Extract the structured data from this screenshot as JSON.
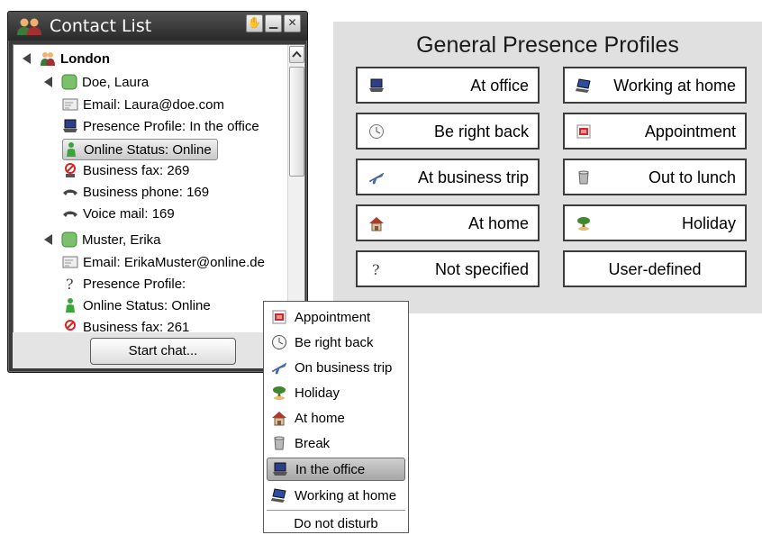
{
  "window": {
    "title": "Contact List",
    "controls": [
      "hand",
      "minimize",
      "close"
    ],
    "start_chat_label": "Start chat..."
  },
  "tree": {
    "group": "London",
    "contacts": [
      {
        "name": "Doe, Laura",
        "email": "Email: Laura@doe.com",
        "presence": "Presence Profile: In the office",
        "online": "Online Status: Online",
        "fax": "Business fax: 269",
        "phone": "Business phone: 169",
        "voicemail": "Voice mail: 169"
      },
      {
        "name": "Muster, Erika",
        "email": "Email: ErikaMuster@online.de",
        "presence": "Presence Profile:",
        "online": "Online Status: Online",
        "fax_partial": "Business fax: 261"
      }
    ],
    "selected_item": "Online Status: Online"
  },
  "profiles_panel": {
    "title": "General Presence Profiles",
    "buttons": [
      {
        "label": "At office",
        "icon": "laptop-icon"
      },
      {
        "label": "Working at home",
        "icon": "laptop-blue-icon"
      },
      {
        "label": "Be right back",
        "icon": "clock-icon"
      },
      {
        "label": "Appointment",
        "icon": "calendar-icon"
      },
      {
        "label": "At business trip",
        "icon": "airplane-icon"
      },
      {
        "label": "Out to lunch",
        "icon": "cup-icon"
      },
      {
        "label": "At home",
        "icon": "house-icon"
      },
      {
        "label": "Holiday",
        "icon": "palm-tree-icon"
      },
      {
        "label": "Not specified",
        "icon": "question-icon"
      },
      {
        "label": "User-defined",
        "icon": ""
      }
    ]
  },
  "menu": {
    "items": [
      {
        "label": "Appointment",
        "icon": "calendar-icon"
      },
      {
        "label": "Be right back",
        "icon": "clock-icon"
      },
      {
        "label": "On business trip",
        "icon": "airplane-icon"
      },
      {
        "label": "Holiday",
        "icon": "palm-tree-icon"
      },
      {
        "label": "At home",
        "icon": "house-icon"
      },
      {
        "label": "Break",
        "icon": "cup-icon"
      },
      {
        "label": "In the office",
        "icon": "laptop-icon"
      },
      {
        "label": "Working at home",
        "icon": "laptop-blue-icon"
      }
    ],
    "extra": "Do not disturb",
    "selected": "In the office"
  },
  "colors": {
    "window_bg": "#3b3b3b",
    "panel_bg": "#e0e0e0",
    "online_green": "#3aa53a",
    "status_green": "#7bc06b"
  }
}
